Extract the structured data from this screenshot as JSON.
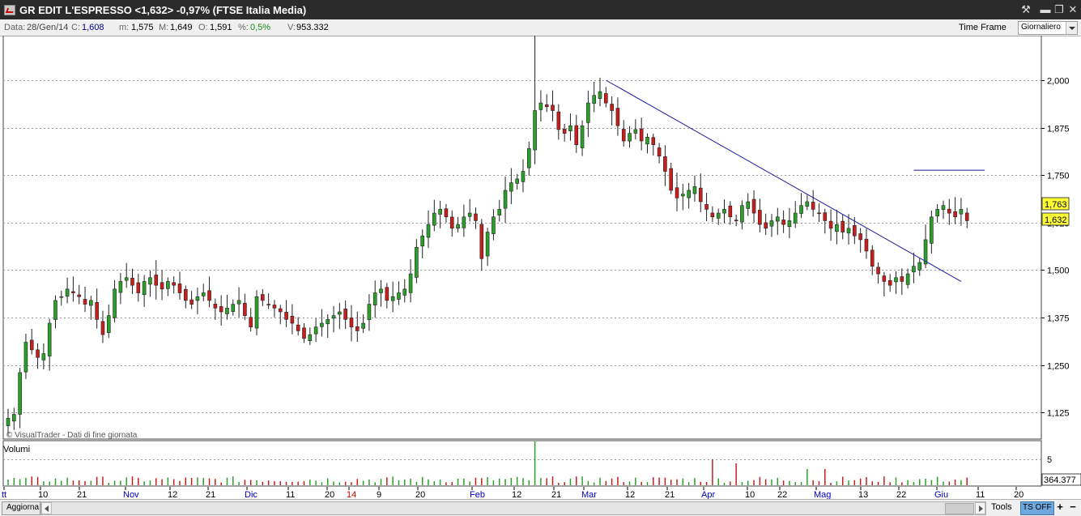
{
  "window": {
    "title": "GR EDIT L'ESPRESSO <1,632> -0,97%  (FTSE Italia Media)",
    "buttons": {
      "tool": "⚒",
      "minimize": "▬",
      "restore": "❐",
      "close": "✕"
    }
  },
  "infobar": {
    "data_label": "Data:",
    "data_value": "28/Gen/14",
    "c_label": "C:",
    "c_value": "1,608",
    "m_label": "m:",
    "m_value": "1,575",
    "max_label": "M:",
    "max_value": "1,649",
    "o_label": "O:",
    "o_value": "1,591",
    "pct_label": "%:",
    "pct_value": "0,5%",
    "v_label": "V:",
    "v_value": "953.332",
    "timeframe_label": "Time Frame",
    "timeframe_value": "Giornaliero"
  },
  "colors": {
    "up": "#2aa02a",
    "down": "#c81e1e",
    "trendline": "#1a1a9c",
    "highlight": "#ffff33"
  },
  "chart_data": {
    "type": "candlestick",
    "price_axis_ticks": [
      "2,000",
      "1,875",
      "1,750",
      "1,625",
      "1,500",
      "1,375",
      "1,250",
      "1,125"
    ],
    "price_range": [
      1.08,
      2.1
    ],
    "price_tags": [
      "1,763",
      "1,632"
    ],
    "watermark": "© VisualTrader - Dati di fine giornata",
    "volume_panel_label": "Volumi",
    "volume_axis_tick": "5",
    "volume_tag": "364.377",
    "x_labels": [
      "tt",
      "10",
      "21",
      "Nov",
      "12",
      "21",
      "Dic",
      "11",
      "20",
      "14",
      "9",
      "20",
      "Feb",
      "12",
      "21",
      "Mar",
      "12",
      "21",
      "Apr",
      "10",
      "22",
      "Mag",
      "13",
      "22",
      "Giu",
      "11",
      "20"
    ],
    "x_label_colors": [
      "blue",
      "black",
      "black",
      "blue",
      "black",
      "black",
      "blue",
      "black",
      "black",
      "red",
      "black",
      "black",
      "blue",
      "black",
      "black",
      "blue",
      "black",
      "black",
      "blue",
      "black",
      "black",
      "blue",
      "black",
      "black",
      "blue",
      "black",
      "black"
    ],
    "closes": [
      1.11,
      1.12,
      1.23,
      1.31,
      1.29,
      1.27,
      1.28,
      1.36,
      1.42,
      1.43,
      1.45,
      1.44,
      1.43,
      1.41,
      1.42,
      1.37,
      1.33,
      1.38,
      1.45,
      1.47,
      1.48,
      1.46,
      1.44,
      1.47,
      1.48,
      1.46,
      1.45,
      1.47,
      1.46,
      1.44,
      1.42,
      1.41,
      1.43,
      1.44,
      1.42,
      1.4,
      1.39,
      1.4,
      1.41,
      1.42,
      1.38,
      1.35,
      1.43,
      1.42,
      1.41,
      1.4,
      1.39,
      1.37,
      1.36,
      1.34,
      1.32,
      1.33,
      1.35,
      1.36,
      1.37,
      1.38,
      1.39,
      1.37,
      1.35,
      1.34,
      1.36,
      1.41,
      1.44,
      1.45,
      1.42,
      1.43,
      1.44,
      1.45,
      1.49,
      1.56,
      1.59,
      1.62,
      1.65,
      1.66,
      1.64,
      1.61,
      1.62,
      1.64,
      1.65,
      1.63,
      1.53,
      1.6,
      1.64,
      1.66,
      1.71,
      1.73,
      1.74,
      1.76,
      1.82,
      1.92,
      1.94,
      1.93,
      1.92,
      1.87,
      1.86,
      1.88,
      1.83,
      1.88,
      1.94,
      1.96,
      1.97,
      1.94,
      1.92,
      1.88,
      1.84,
      1.86,
      1.87,
      1.84,
      1.85,
      1.83,
      1.8,
      1.76,
      1.71,
      1.69,
      1.7,
      1.71,
      1.72,
      1.68,
      1.66,
      1.64,
      1.65,
      1.66,
      1.64,
      1.63,
      1.67,
      1.68,
      1.65,
      1.62,
      1.61,
      1.63,
      1.64,
      1.62,
      1.63,
      1.65,
      1.67,
      1.68,
      1.66,
      1.65,
      1.63,
      1.61,
      1.62,
      1.6,
      1.61,
      1.59,
      1.58,
      1.55,
      1.51,
      1.49,
      1.47,
      1.46,
      1.48,
      1.47,
      1.49,
      1.51,
      1.52,
      1.58,
      1.64,
      1.66,
      1.67,
      1.65,
      1.64,
      1.66,
      1.63
    ],
    "trendline_from": {
      "bar": 101,
      "price": 2.0
    },
    "trendline_to": {
      "bar": 161,
      "price": 1.47
    },
    "resistance_from": {
      "bar": 153,
      "price": 1.763
    },
    "resistance_to": {
      "bar": 165,
      "price": 1.763
    }
  },
  "bottombar": {
    "aggiorna": "Aggiorna",
    "tools": "Tools",
    "ts_off": "TS OFF",
    "zoom_in": "+",
    "zoom_out": "−"
  }
}
